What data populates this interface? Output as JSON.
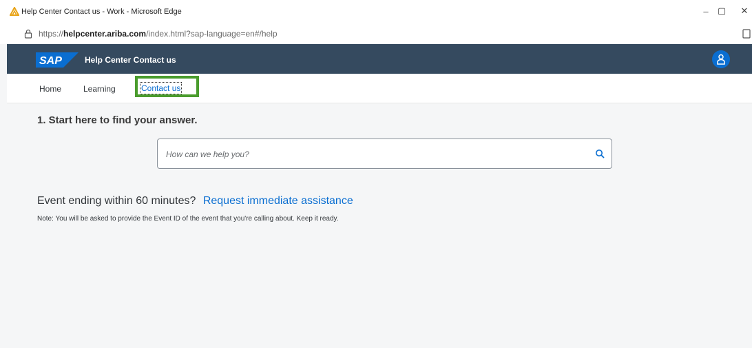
{
  "window": {
    "title": "Help Center Contact us - Work - Microsoft Edge",
    "controls": {
      "minimize": "–",
      "maximize": "▢",
      "close": "✕"
    }
  },
  "address_bar": {
    "url_prefix": "https://",
    "url_host": "helpcenter.ariba.com",
    "url_path": "/index.html?sap-language=en#/help"
  },
  "header": {
    "logo": "SAP",
    "title": "Help Center Contact us",
    "brand_color": "#354a5f"
  },
  "nav": {
    "items": [
      {
        "label": "Home"
      },
      {
        "label": "Learning"
      },
      {
        "label": "Contact us",
        "active": true
      }
    ],
    "highlight_color": "#4a9c2d"
  },
  "main": {
    "heading": "1. Start here to find your answer.",
    "search": {
      "placeholder": "How can we help you?"
    },
    "event_question": "Event ending within 60 minutes?",
    "event_link": "Request immediate assistance",
    "note": "Note: You will be asked to provide the Event ID of the event that you're calling about. Keep it ready.",
    "link_color": "#0a6ed1"
  }
}
